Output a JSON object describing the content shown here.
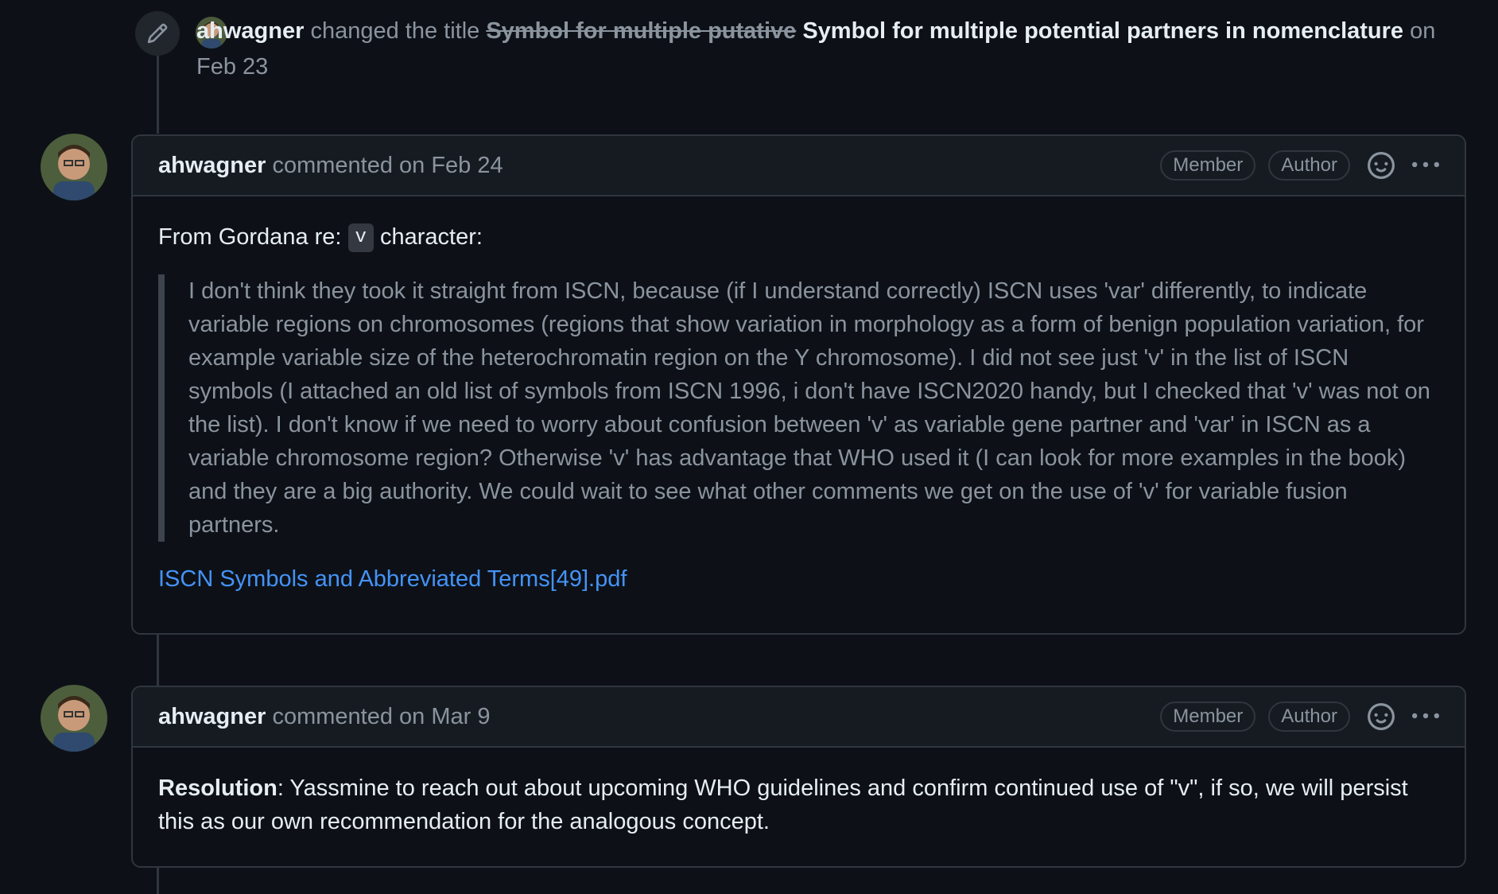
{
  "title_event": {
    "actor": "ahwagner",
    "action": "changed the title",
    "old_title": "Symbol for multiple putative",
    "new_title": "Symbol for multiple potential partners in nomenclature",
    "date": "on Feb 23"
  },
  "comments": [
    {
      "author": "ahwagner",
      "meta": "commented on Feb 24",
      "badges": [
        "Member",
        "Author"
      ],
      "intro_before": "From Gordana re:",
      "intro_code": "v",
      "intro_after": "character:",
      "quote": "I don't think they took it straight from ISCN, because (if I understand correctly) ISCN uses 'var' differently, to indicate variable regions on chromosomes (regions that show variation in morphology as a form of benign population variation, for example variable size of the heterochromatin region on the Y chromosome). I did not see just 'v' in the list of ISCN symbols (I attached an old list of symbols from ISCN 1996, i don't have ISCN2020 handy, but I checked that 'v' was not on the list). I don't know if we need to worry about confusion between 'v' as variable gene partner and 'var' in ISCN as a variable chromosome region? Otherwise 'v' has advantage that WHO used it (I can look for more examples in the book) and they are a big authority. We could wait to see what other comments we get on the use of 'v' for variable fusion partners.",
      "attachment": "ISCN Symbols and Abbreviated Terms[49].pdf"
    },
    {
      "author": "ahwagner",
      "meta": "commented on Mar 9",
      "badges": [
        "Member",
        "Author"
      ],
      "resolution_label": "Resolution",
      "resolution_text": ": Yassmine to reach out about upcoming WHO guidelines and confirm continued use of \"v\", if so, we will persist this as our own recommendation for the analogous concept."
    }
  ],
  "icons": {
    "edit": "pencil-icon",
    "reaction": "smiley-icon",
    "menu": "kebab-horizontal-icon",
    "avatar": "user-avatar"
  }
}
